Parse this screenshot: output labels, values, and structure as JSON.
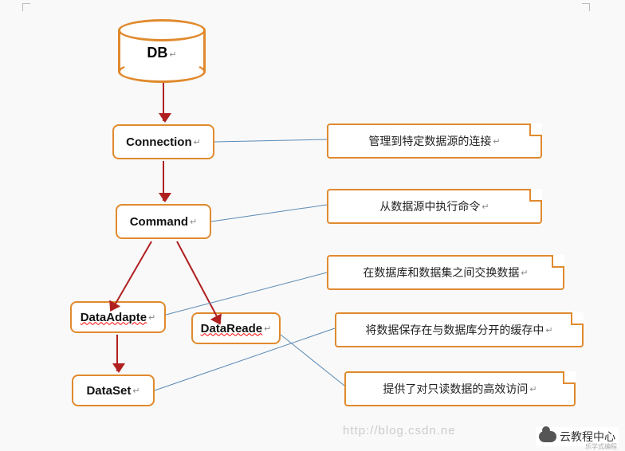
{
  "nodes": {
    "db": "DB",
    "connection": "Connection",
    "command": "Command",
    "dataAdapter": "DataAdapte",
    "dataReader": "DataReade",
    "dataSet": "DataSet"
  },
  "callouts": {
    "connection_desc": "管理到特定数据源的连接",
    "command_desc": "从数据源中执行命令",
    "adapter_desc": "在数据库和数据集之间交换数据",
    "dataset_desc": "将数据保存在与数据库分开的缓存中",
    "reader_desc": "提供了对只读数据的高效访问"
  },
  "meta": {
    "watermark_url": "http://blog.csdn.ne",
    "logo_text": "云教程中心",
    "logo_sub": "乐学式编程"
  },
  "return_mark": "↵"
}
